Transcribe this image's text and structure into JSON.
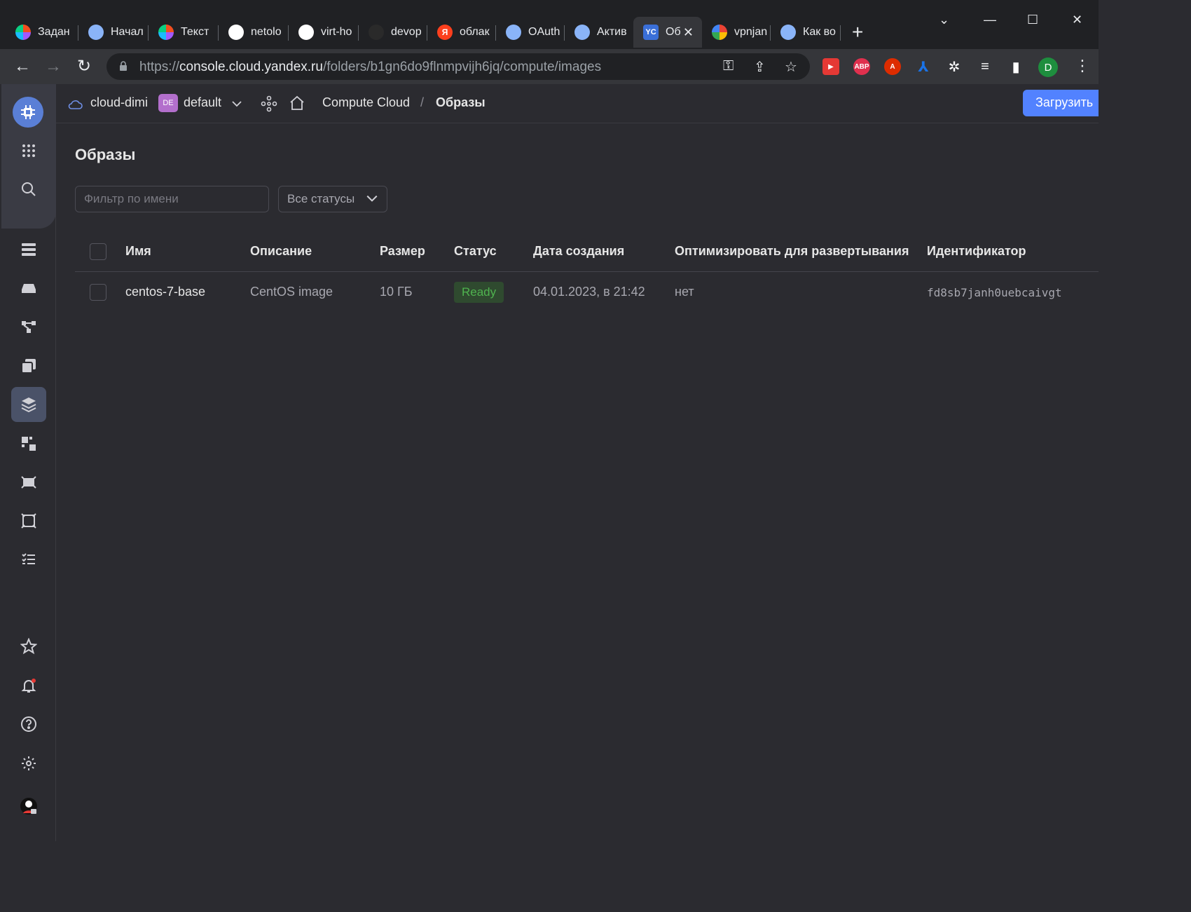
{
  "browser": {
    "tabs": [
      {
        "label": "Задан",
        "icon": "figma-icon",
        "color": "#f24e1e"
      },
      {
        "label": "Начал",
        "icon": "compass-icon",
        "color": "#8ab4f8"
      },
      {
        "label": "Текст",
        "icon": "figma-icon",
        "color": "#a259ff"
      },
      {
        "label": "netolo",
        "icon": "github-icon",
        "color": "#ffffff"
      },
      {
        "label": "virt-ho",
        "icon": "github-icon",
        "color": "#ffffff"
      },
      {
        "label": "devop",
        "icon": "github-icon",
        "color": "#222222"
      },
      {
        "label": "облак",
        "icon": "yandex-icon",
        "color": "#fc3f1d"
      },
      {
        "label": "OAuth",
        "icon": "compass-icon",
        "color": "#8ab4f8"
      },
      {
        "label": "Актив",
        "icon": "compass-icon",
        "color": "#8ab4f8"
      },
      {
        "label": "Об",
        "icon": "yc-icon",
        "color": "#3a6fd8",
        "active": true
      },
      {
        "label": "vpnjan",
        "icon": "google-icon",
        "color": "#ffffff"
      },
      {
        "label": "Как во",
        "icon": "compass-icon",
        "color": "#8ab4f8"
      }
    ],
    "url_prefix": "https://",
    "url_host": "console.cloud.yandex.ru",
    "url_path": "/folders/b1gn6do9flnmpvijh6jq/compute/images",
    "profile_initial": "D",
    "extensions": [
      {
        "name": "youtube-ext-icon",
        "label": "▶",
        "color": "#e53935"
      },
      {
        "name": "adblock-icon",
        "label": "ABP",
        "color": "#e0304e"
      },
      {
        "name": "angular-icon",
        "label": "A",
        "color": "#dd2c00"
      },
      {
        "name": "acrobat-icon",
        "label": "⅄",
        "color": "#1a73e8"
      }
    ]
  },
  "header": {
    "cloud_name": "cloud-dimi",
    "folder_badge": "DE",
    "folder_name": "default",
    "service": "Compute Cloud",
    "separator": "/",
    "current": "Образы",
    "upload_label": "Загрузить"
  },
  "page": {
    "title": "Образы",
    "filter_placeholder": "Фильтр по имени",
    "status_filter": "Все статусы"
  },
  "table": {
    "columns": [
      "Имя",
      "Описание",
      "Размер",
      "Статус",
      "Дата создания",
      "Оптимизировать для развертывания",
      "Идентификатор"
    ],
    "rows": [
      {
        "name": "centos-7-base",
        "description": "CentOS image",
        "size": "10 ГБ",
        "status": "Ready",
        "created": "04.01.2023, в 21:42",
        "optimize": "нет",
        "id": "fd8sb7janh0uebcaivgt"
      }
    ]
  },
  "colors": {
    "accent": "#5282ff",
    "status_ready": "#4fb34f"
  }
}
